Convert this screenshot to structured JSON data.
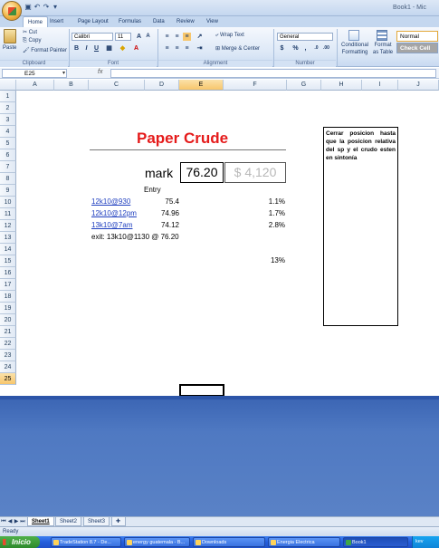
{
  "window": {
    "title": "Book1 - Mic"
  },
  "ribbon": {
    "tabs": [
      "Home",
      "Insert",
      "Page Layout",
      "Formulas",
      "Data",
      "Review",
      "View"
    ],
    "clipboard": {
      "paste": "Paste",
      "cut": "Cut",
      "copy": "Copy",
      "format_painter": "Format Painter",
      "label": "Clipboard"
    },
    "font": {
      "name": "Calibri",
      "size": "11",
      "label": "Font"
    },
    "alignment": {
      "wrap_text": "Wrap Text",
      "merge_center": "Merge & Center",
      "label": "Alignment"
    },
    "number": {
      "format": "General",
      "label": "Number"
    },
    "styles": {
      "conditional": "Conditional",
      "formatting": "Formatting",
      "format_as": "Format",
      "as_table": "as Table",
      "normal": "Normal",
      "check_cell": "Check Cell"
    }
  },
  "formula_bar": {
    "name_box": "E25",
    "fx": "fx",
    "content": ""
  },
  "columns": [
    "A",
    "B",
    "C",
    "D",
    "E",
    "F",
    "G",
    "H",
    "I",
    "J"
  ],
  "selected_column": "E",
  "rows": [
    "1",
    "2",
    "3",
    "4",
    "5",
    "6",
    "7",
    "8",
    "9",
    "10",
    "11",
    "12",
    "13",
    "14",
    "15",
    "16",
    "17",
    "18",
    "19",
    "20",
    "21",
    "22",
    "23",
    "24",
    "25"
  ],
  "selected_row": "25",
  "cells": {
    "title": "Paper Crude",
    "mark_label": "mark",
    "mark_value": "76.20",
    "mark_dollar": "$ 4,120",
    "entry_header": "Entry",
    "trades": [
      {
        "label": "12k10@930",
        "price": "75.4",
        "pct": "1.1%"
      },
      {
        "label": "12k10@12pm",
        "price": "74.96",
        "pct": "1.7%"
      },
      {
        "label": "13k10@7am",
        "price": "74.12",
        "pct": "2.8%"
      }
    ],
    "exit": "exit: 13k10@1130 @ 76.20",
    "total_pct": "13%",
    "note": "Cerrar posicion hasta que la posicion relativa del sp y el crudo esten en sintonía"
  },
  "sheet_tabs": [
    "Sheet1",
    "Sheet2",
    "Sheet3"
  ],
  "status": {
    "text": "Ready"
  },
  "taskbar": {
    "start": "Inicio",
    "items": [
      "TradeStation 8.7 - De...",
      "energy guatemala - B...",
      "Downloads",
      "Energia Electrica",
      "Book1",
      "kev"
    ]
  },
  "colors": {
    "title_red": "#e51b1b",
    "link_blue": "#1f3fbf",
    "lower_blue": "#4f79c2"
  }
}
